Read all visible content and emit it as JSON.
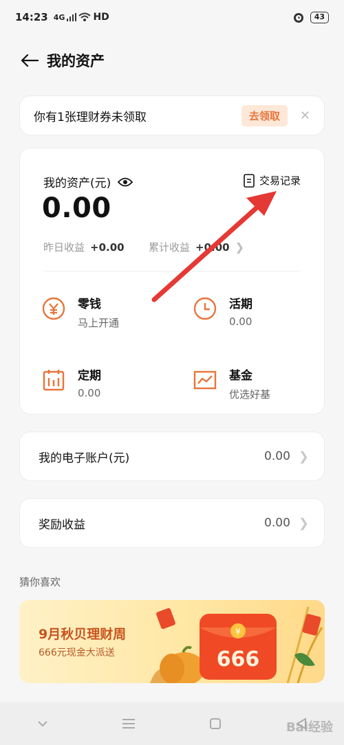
{
  "status_bar": {
    "time": "14:23",
    "network": "4G",
    "hd": "HD",
    "battery": "43"
  },
  "nav": {
    "title": "我的资产"
  },
  "banner": {
    "text": "你有1张理财券未领取",
    "claim_label": "去领取",
    "close_glyph": "✕"
  },
  "assets": {
    "label": "我的资产(元)",
    "records_label": "交易记录",
    "amount": "0.00",
    "yesterday_label": "昨日收益",
    "yesterday_value": "+0.00",
    "cumulative_label": "累计收益",
    "cumulative_value": "+0.00",
    "products": [
      {
        "name": "零钱",
        "sub": "马上开通",
        "icon": "yuan-icon"
      },
      {
        "name": "活期",
        "sub": "0.00",
        "icon": "clock-icon"
      },
      {
        "name": "定期",
        "sub": "0.00",
        "icon": "calendar-icon"
      },
      {
        "name": "基金",
        "sub": "优选好基",
        "icon": "chart-icon"
      }
    ]
  },
  "rows": [
    {
      "label": "我的电子账户(元)",
      "value": "0.00"
    },
    {
      "label": "奖励收益",
      "value": "0.00"
    }
  ],
  "guess_title": "猜你喜欢",
  "promo": {
    "headline": "9月秋贝理财周",
    "subline": "666元现金大派送",
    "envelope_text": "666"
  },
  "watermark": "Bai经验",
  "colors": {
    "accent": "#e8743a",
    "arrow": "#e53935"
  }
}
